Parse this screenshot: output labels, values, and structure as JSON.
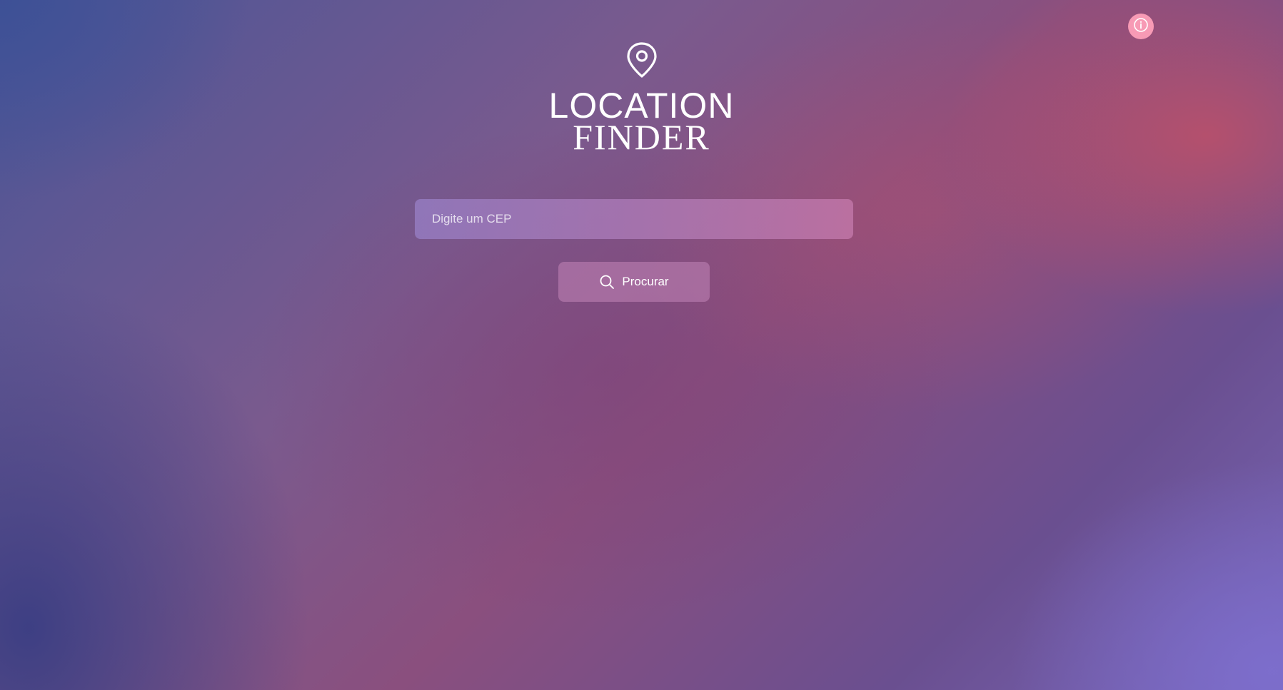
{
  "info": {
    "icon": "info-icon"
  },
  "logo": {
    "icon": "map-pin-icon",
    "line1": "LOCATION",
    "line2": "FINDER"
  },
  "search": {
    "placeholder": "Digite um CEP",
    "value": "",
    "button_label": "Procurar",
    "button_icon": "search-icon"
  },
  "colors": {
    "info_button": "#f79ab5",
    "text": "#ffffff"
  }
}
